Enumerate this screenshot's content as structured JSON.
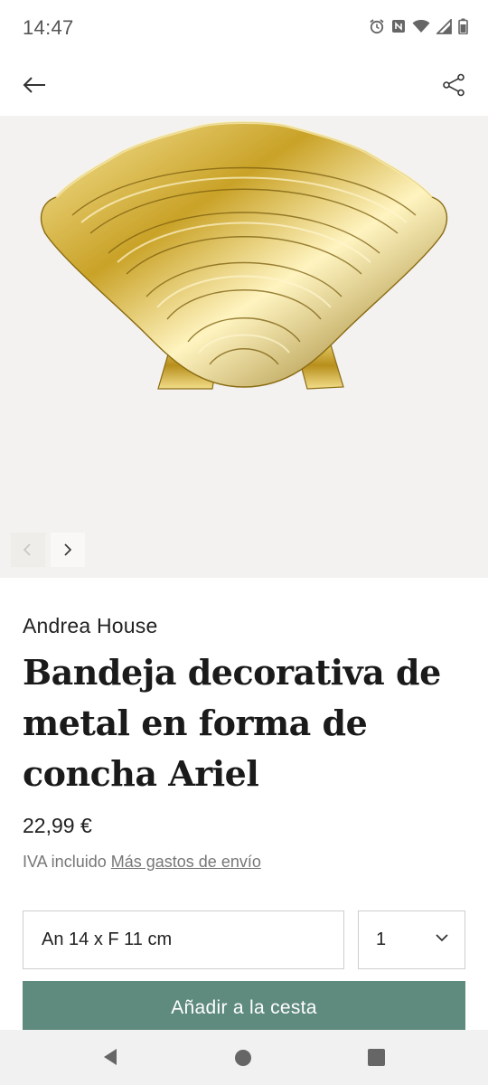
{
  "status_bar": {
    "time": "14:47",
    "icons": [
      "alarm-icon",
      "nfc-icon",
      "wifi-icon",
      "signal-icon",
      "battery-icon"
    ]
  },
  "app_bar": {
    "icons": [
      "arrow-left-icon",
      "share-icon"
    ]
  },
  "gallery": {
    "image_subject": "gold scallop shell tray",
    "controls": [
      "chevron-left-icon",
      "chevron-right-icon"
    ]
  },
  "product": {
    "brand": "Andrea House",
    "title": "Bandeja decorativa de metal en forma de concha Ariel",
    "price": "22,99 €",
    "tax_note": "IVA incluido",
    "shipping_link": "Más gastos de envío"
  },
  "options": {
    "size_value": "An 14 x F 11 cm",
    "quantity_value": "1"
  },
  "cta": {
    "add_to_basket": "Añadir a la cesta"
  },
  "colors": {
    "accent": "#5f8a7e",
    "gallery_bg": "#f3f2f0",
    "gold": "#c9a227"
  }
}
